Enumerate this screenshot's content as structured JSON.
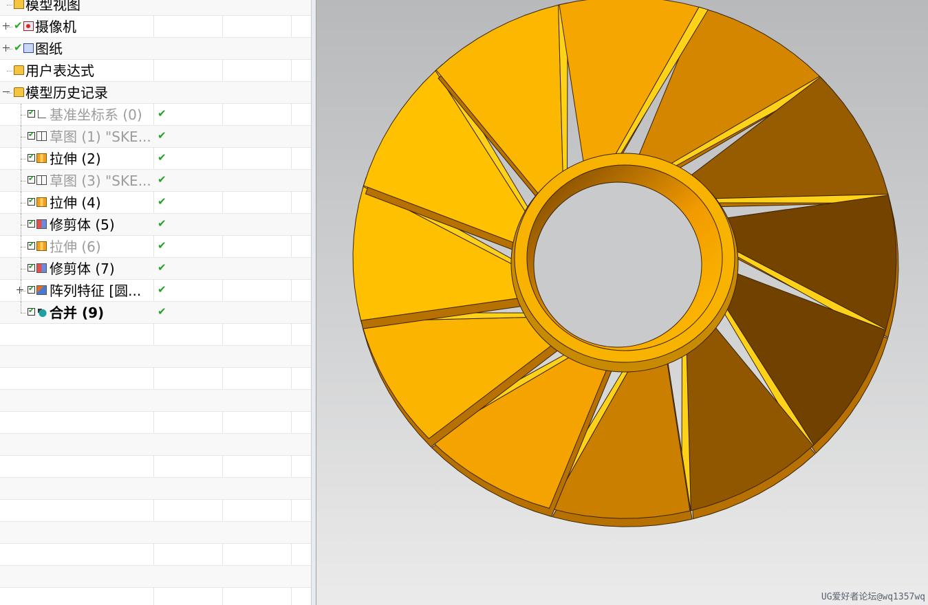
{
  "tree": {
    "rows": [
      {
        "label": "模型视图",
        "kind": "top",
        "expander": "none",
        "check": "none",
        "icon": "model-view-icon",
        "grey": false,
        "bold": false,
        "status": ""
      },
      {
        "label": "摄像机",
        "kind": "top",
        "expander": "plus",
        "check": "green",
        "icon": "camera-icon",
        "grey": false,
        "bold": false,
        "status": ""
      },
      {
        "label": "图纸",
        "kind": "top",
        "expander": "plus",
        "check": "green",
        "icon": "drawing-icon",
        "grey": false,
        "bold": false,
        "status": ""
      },
      {
        "label": "用户表达式",
        "kind": "top",
        "expander": "none",
        "check": "none",
        "icon": "folder-icon",
        "grey": false,
        "bold": false,
        "status": ""
      },
      {
        "label": "模型历史记录",
        "kind": "top",
        "expander": "minus",
        "check": "none",
        "icon": "folder-open-icon",
        "grey": false,
        "bold": false,
        "status": ""
      },
      {
        "label": "基准坐标系 (0)",
        "kind": "feature",
        "expander": "none",
        "check": "box",
        "icon": "datum-csys-icon",
        "grey": true,
        "bold": false,
        "status": "✔"
      },
      {
        "label": "草图 (1) \"SKE...",
        "kind": "feature",
        "expander": "none",
        "check": "box",
        "icon": "sketch-icon",
        "grey": true,
        "bold": false,
        "status": "✔"
      },
      {
        "label": "拉伸 (2)",
        "kind": "feature",
        "expander": "none",
        "check": "box",
        "icon": "extrude-icon",
        "grey": false,
        "bold": false,
        "status": "✔"
      },
      {
        "label": "草图 (3) \"SKE...",
        "kind": "feature",
        "expander": "none",
        "check": "box",
        "icon": "sketch-icon",
        "grey": true,
        "bold": false,
        "status": "✔"
      },
      {
        "label": "拉伸 (4)",
        "kind": "feature",
        "expander": "none",
        "check": "box",
        "icon": "extrude-icon",
        "grey": false,
        "bold": false,
        "status": "✔"
      },
      {
        "label": "修剪体 (5)",
        "kind": "feature",
        "expander": "none",
        "check": "box",
        "icon": "trim-body-icon",
        "grey": false,
        "bold": false,
        "status": "✔"
      },
      {
        "label": "拉伸 (6)",
        "kind": "feature",
        "expander": "none",
        "check": "box",
        "icon": "extrude-icon",
        "grey": true,
        "bold": false,
        "status": "✔"
      },
      {
        "label": "修剪体 (7)",
        "kind": "feature",
        "expander": "none",
        "check": "box",
        "icon": "trim-body-icon",
        "grey": false,
        "bold": false,
        "status": "✔"
      },
      {
        "label": "阵列特征 [圆...",
        "kind": "feature",
        "expander": "plus",
        "check": "box",
        "icon": "pattern-feature-icon",
        "grey": false,
        "bold": false,
        "status": "✔"
      },
      {
        "label": "合并 (9)",
        "kind": "feature",
        "expander": "none",
        "check": "box",
        "icon": "unite-icon",
        "grey": false,
        "bold": true,
        "status": "✔"
      }
    ],
    "empty_rows": 14
  },
  "viewport": {
    "background_top": "#b8b9bb",
    "background_bottom": "#ebebeb",
    "blade_count": 12,
    "colors": {
      "light": "#ffc200",
      "mid": "#f29a00",
      "dark": "#6e3f00",
      "edge": "#ffd21a",
      "ring": "#f7b300"
    }
  },
  "watermark": "UG爱好者论坛@wq1357wq"
}
